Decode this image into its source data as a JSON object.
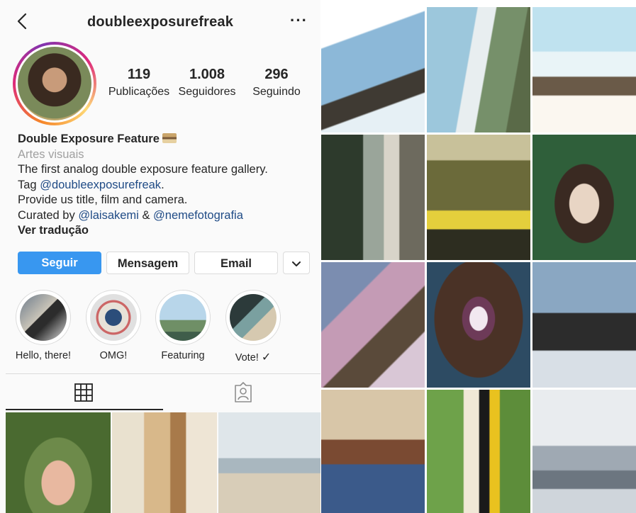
{
  "header": {
    "username": "doubleexposurefreak",
    "back_icon": "chevron-left-icon",
    "more_label": "···"
  },
  "stats": [
    {
      "value": "119",
      "label": "Publicações"
    },
    {
      "value": "1.008",
      "label": "Seguidores"
    },
    {
      "value": "296",
      "label": "Seguindo"
    }
  ],
  "bio": {
    "name": "Double Exposure Feature",
    "category": "Artes visuais",
    "line1": "The first analog double exposure feature gallery.",
    "tag_prefix": "Tag",
    "tag_handle": "@doubleexposurefreak",
    "tag_suffix": ".",
    "line3": "Provide us title, film and camera.",
    "curated_prefix": "Curated by",
    "curator1": "@laisakemi",
    "curated_and": "&",
    "curator2": "@nemefotografia",
    "translate": "Ver tradução"
  },
  "actions": {
    "follow": "Seguir",
    "message": "Mensagem",
    "email": "Email",
    "dropdown": "⌄"
  },
  "highlights": [
    {
      "label": "Hello, there!"
    },
    {
      "label": "OMG!"
    },
    {
      "label": "Featuring"
    },
    {
      "label": "Vote!",
      "suffix": "✓"
    }
  ],
  "tabs": {
    "grid_icon": "grid-icon",
    "tagged_icon": "tagged-person-icon"
  },
  "colors": {
    "primary": "#3897f0",
    "link": "#1f4b86",
    "muted": "#a0a0a0",
    "border": "#dbdbdb"
  }
}
